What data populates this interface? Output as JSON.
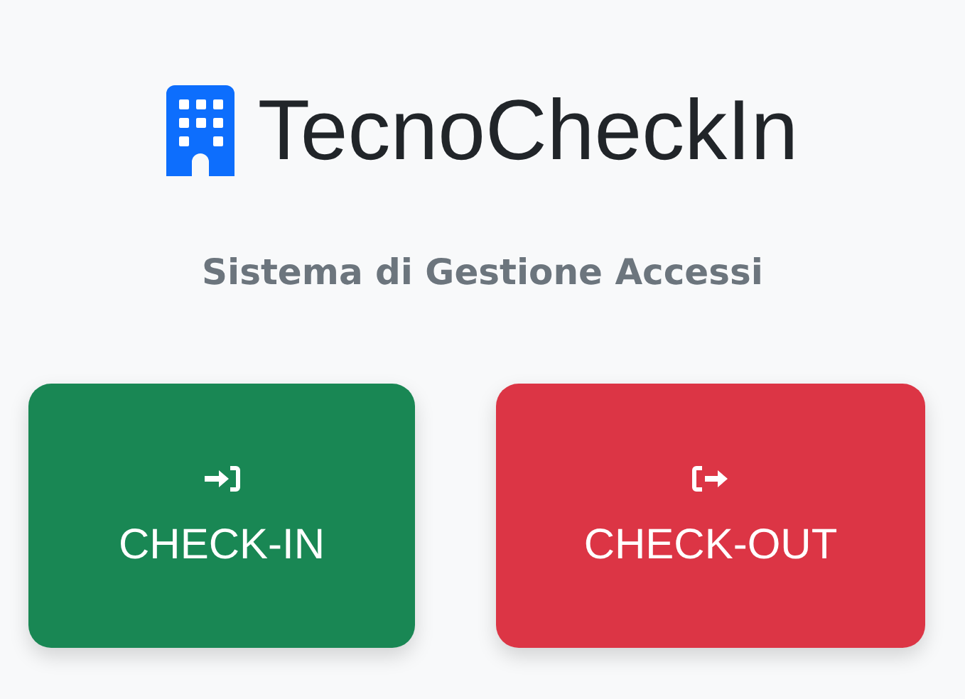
{
  "brand": {
    "title": "TecnoCheckIn"
  },
  "subtitle": "Sistema di Gestione Accessi",
  "buttons": [
    {
      "kind": "check-in",
      "label": "CHECK-IN",
      "color": "#198754"
    },
    {
      "kind": "check-out",
      "label": "CHECK-OUT",
      "color": "#dc3545"
    }
  ]
}
